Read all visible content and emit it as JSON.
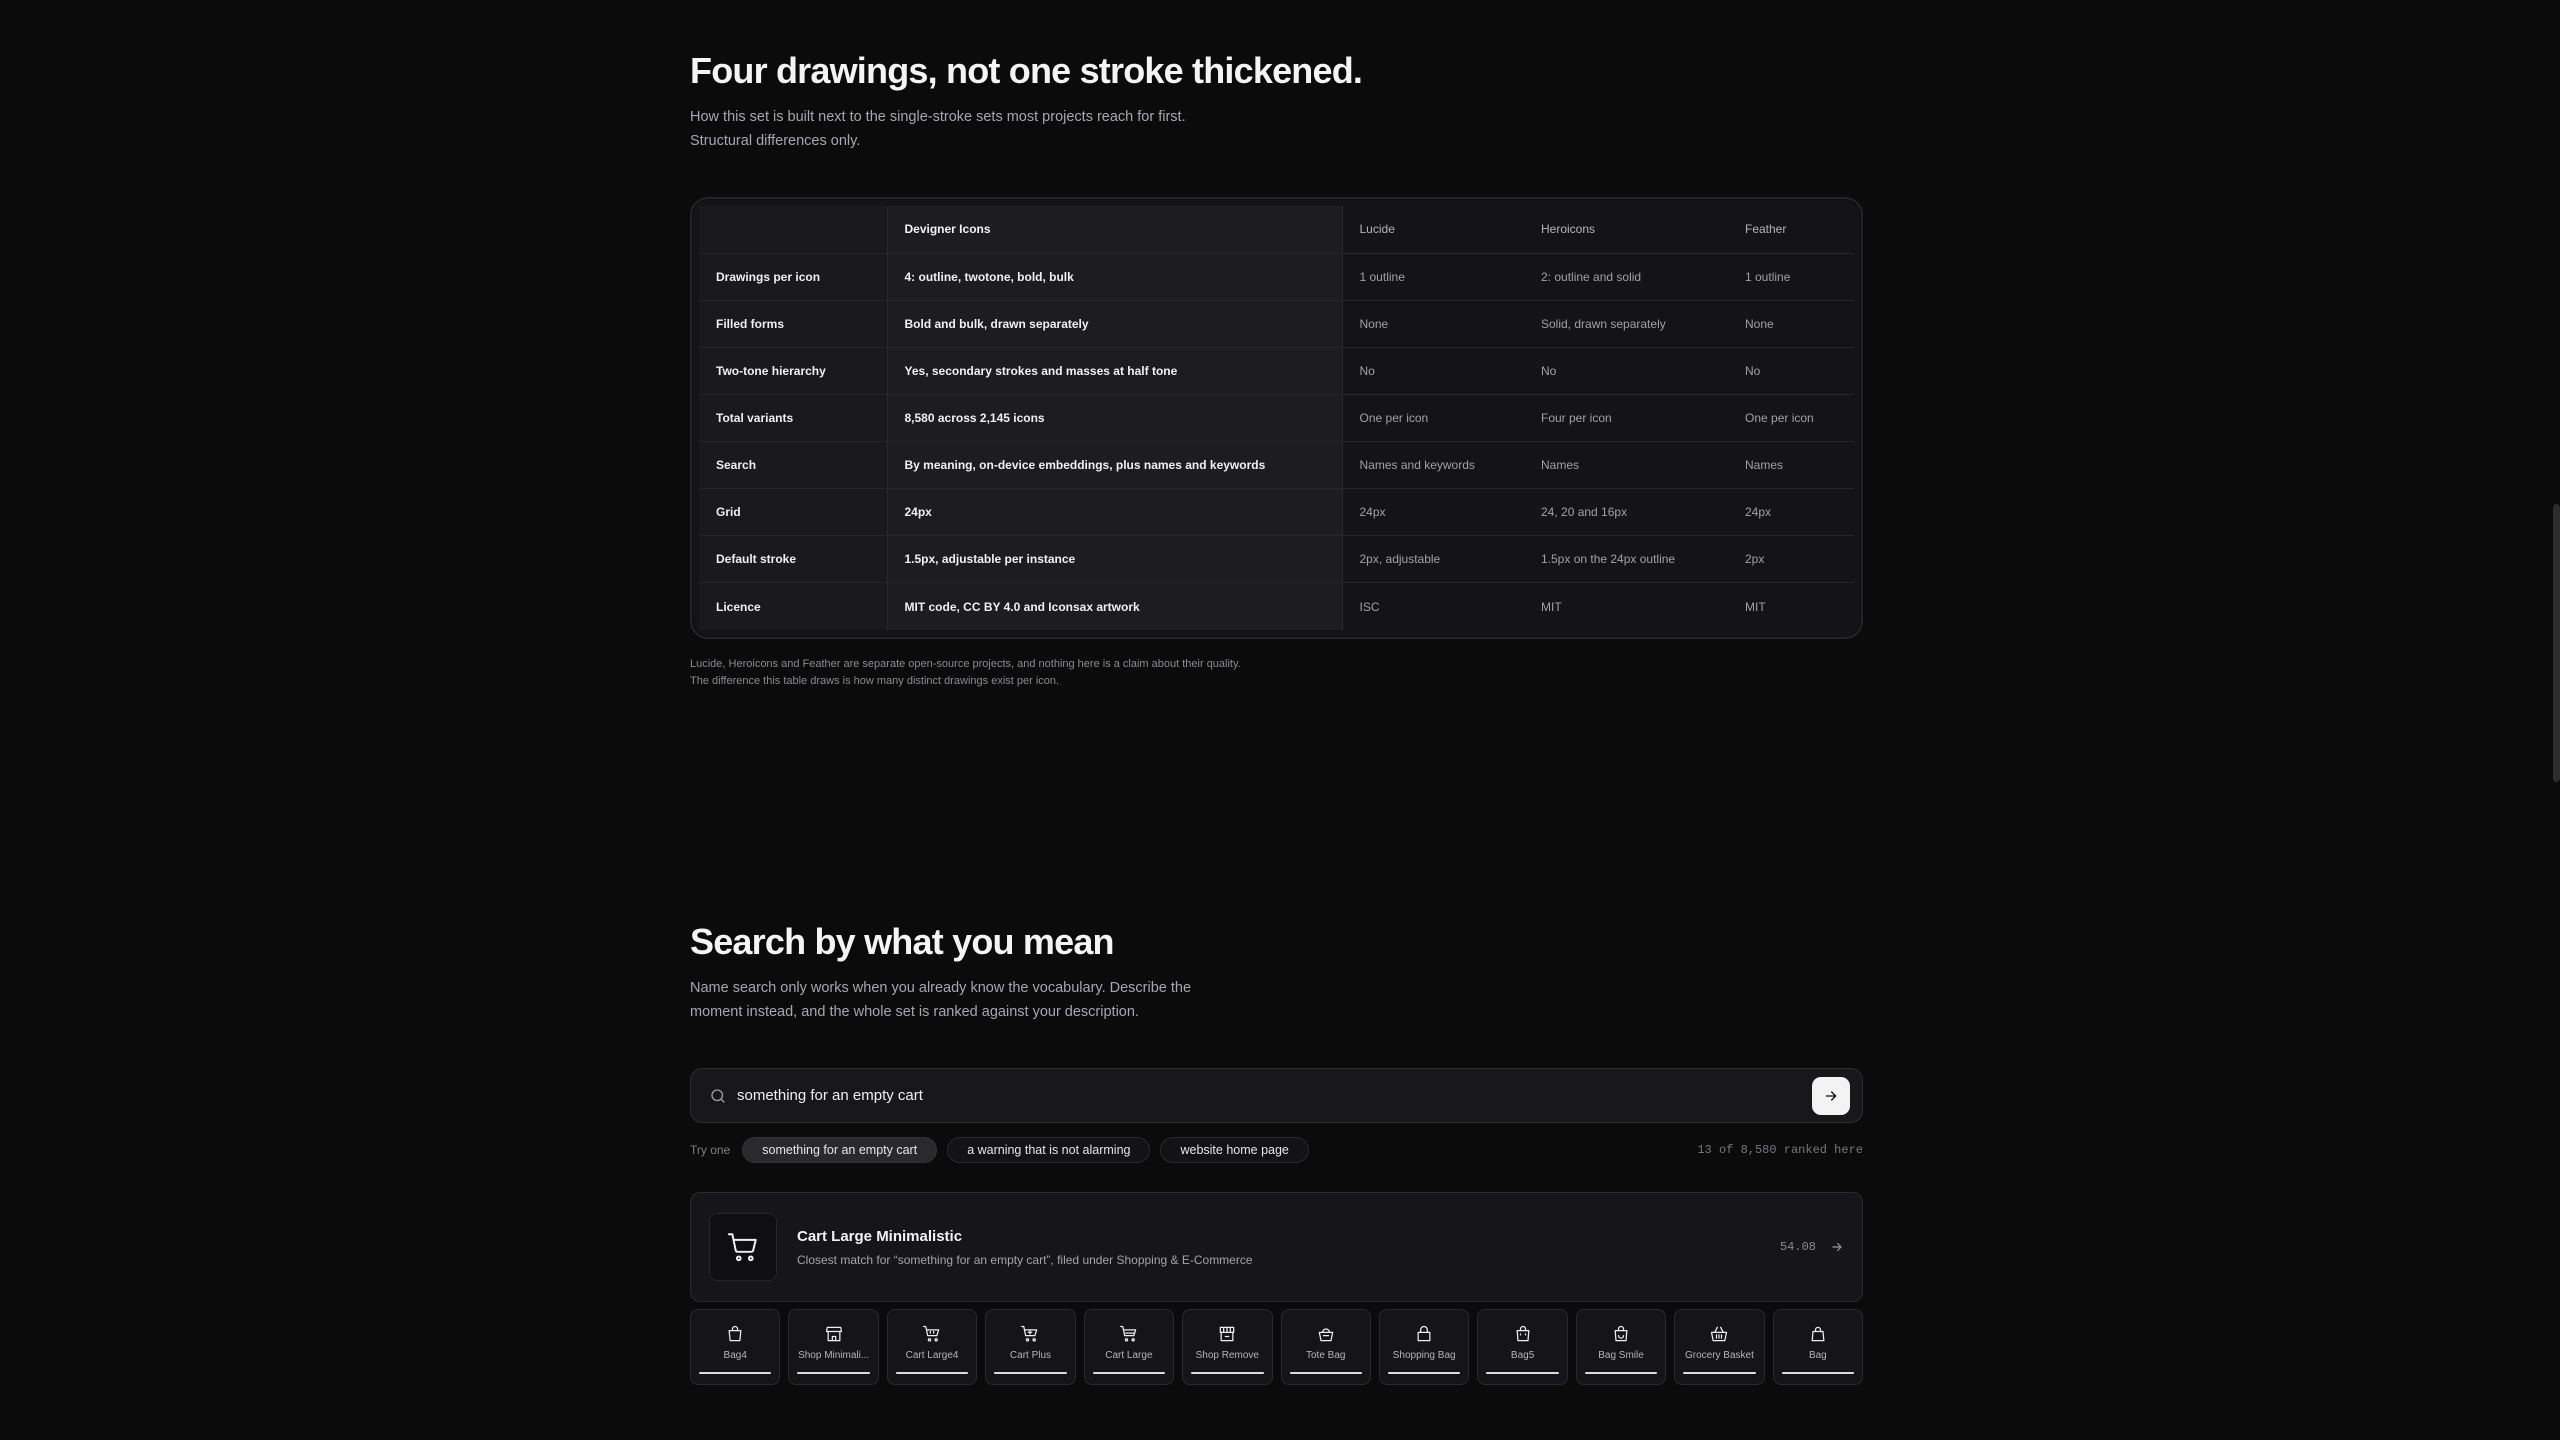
{
  "compare": {
    "title": "Four drawings, not one stroke thickened.",
    "lede_1": "How this set is built next to the single-stroke sets most projects reach for first.",
    "lede_2": "Structural differences only.",
    "headers": [
      "",
      "Devigner Icons",
      "Lucide",
      "Heroicons",
      "Feather"
    ],
    "rows": [
      [
        "Drawings per icon",
        "4: outline, twotone, bold, bulk",
        "1 outline",
        "2: outline and solid",
        "1 outline"
      ],
      [
        "Filled forms",
        "Bold and bulk, drawn separately",
        "None",
        "Solid, drawn separately",
        "None"
      ],
      [
        "Two-tone hierarchy",
        "Yes, secondary strokes and masses at half tone",
        "No",
        "No",
        "No"
      ],
      [
        "Total variants",
        "8,580 across 2,145 icons",
        "One per icon",
        "Four per icon",
        "One per icon"
      ],
      [
        "Search",
        "By meaning, on-device embeddings, plus names and keywords",
        "Names and keywords",
        "Names",
        "Names"
      ],
      [
        "Grid",
        "24px",
        "24px",
        "24, 20 and 16px",
        "24px"
      ],
      [
        "Default stroke",
        "1.5px, adjustable per instance",
        "2px, adjustable",
        "1.5px on the 24px outline",
        "2px"
      ],
      [
        "Licence",
        "MIT code, CC BY 4.0 and Iconsax artwork",
        "ISC",
        "MIT",
        "MIT"
      ]
    ],
    "footnote_1": "Lucide, Heroicons and Feather are separate open-source projects, and nothing here is a claim about their quality.",
    "footnote_2": "The difference this table draws is how many distinct drawings exist per icon."
  },
  "search": {
    "title": "Search by what you mean",
    "lede_1": "Name search only works when you already know the vocabulary. Describe the",
    "lede_2": "moment instead, and the whole set is ranked against your description.",
    "query": "something for an empty cart",
    "try_label": "Try one",
    "chips": [
      "something for an empty cart",
      "a warning that is not alarming",
      "website home page"
    ],
    "ranked": "13 of 8,580 ranked here",
    "top_result": {
      "title": "Cart Large Minimalistic",
      "desc": "Closest match for “something for an empty cart”, filed under Shopping & E-Commerce",
      "score": "54.08"
    },
    "tiles": [
      "Bag4",
      "Shop Minimali...",
      "Cart Large4",
      "Cart Plus",
      "Cart Large",
      "Shop Remove",
      "Tote Bag",
      "Shopping Bag",
      "Bag5",
      "Bag Smile",
      "Grocery Basket",
      "Bag"
    ]
  },
  "icons": {
    "search": "search-icon",
    "arrow": "arrow-right-icon",
    "cart": "cart-icon",
    "bag": "bag-icon",
    "shop": "shop-icon",
    "basket": "basket-icon"
  },
  "colors": {
    "background": "#0b0b0c",
    "accent": "#f3f3f4"
  }
}
